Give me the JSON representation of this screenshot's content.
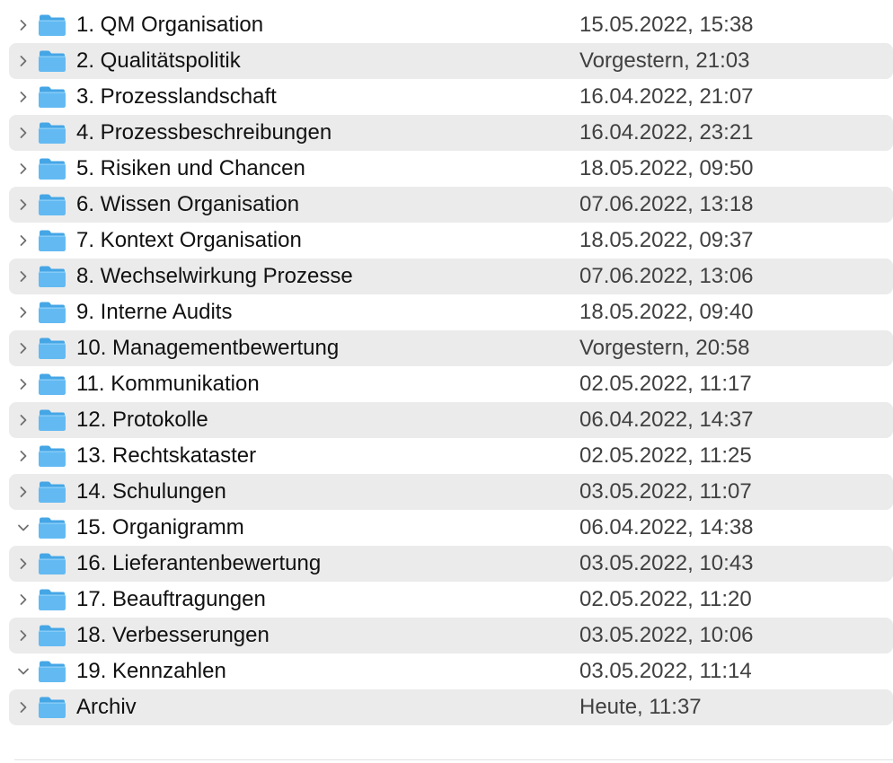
{
  "items": [
    {
      "name": "1. QM Organisation",
      "modified": "15.05.2022, 15:38",
      "expanded": false
    },
    {
      "name": "2. Qualitätspolitik",
      "modified": "Vorgestern, 21:03",
      "expanded": false
    },
    {
      "name": "3. Prozesslandschaft",
      "modified": "16.04.2022, 21:07",
      "expanded": false
    },
    {
      "name": "4. Prozessbeschreibungen",
      "modified": "16.04.2022, 23:21",
      "expanded": false
    },
    {
      "name": "5. Risiken und Chancen",
      "modified": "18.05.2022, 09:50",
      "expanded": false
    },
    {
      "name": "6. Wissen Organisation",
      "modified": "07.06.2022, 13:18",
      "expanded": false
    },
    {
      "name": "7. Kontext Organisation",
      "modified": "18.05.2022, 09:37",
      "expanded": false
    },
    {
      "name": "8. Wechselwirkung Prozesse",
      "modified": "07.06.2022, 13:06",
      "expanded": false
    },
    {
      "name": "9. Interne Audits",
      "modified": "18.05.2022, 09:40",
      "expanded": false
    },
    {
      "name": "10. Managementbewertung",
      "modified": "Vorgestern, 20:58",
      "expanded": false
    },
    {
      "name": "11. Kommunikation",
      "modified": "02.05.2022, 11:17",
      "expanded": false
    },
    {
      "name": "12. Protokolle",
      "modified": "06.04.2022, 14:37",
      "expanded": false
    },
    {
      "name": "13. Rechtskataster",
      "modified": "02.05.2022, 11:25",
      "expanded": false
    },
    {
      "name": "14. Schulungen",
      "modified": "03.05.2022, 11:07",
      "expanded": false
    },
    {
      "name": "15. Organigramm",
      "modified": "06.04.2022, 14:38",
      "expanded": true
    },
    {
      "name": "16. Lieferantenbewertung",
      "modified": "03.05.2022, 10:43",
      "expanded": false
    },
    {
      "name": "17. Beauftragungen",
      "modified": "02.05.2022, 11:20",
      "expanded": false
    },
    {
      "name": "18. Verbesserungen",
      "modified": "03.05.2022, 10:06",
      "expanded": false
    },
    {
      "name": "19. Kennzahlen",
      "modified": "03.05.2022, 11:14",
      "expanded": true
    },
    {
      "name": "Archiv",
      "modified": "Heute, 11:37",
      "expanded": false
    }
  ],
  "icons": {
    "folder": "folder-icon",
    "collapsed": "chevron-right-icon",
    "expanded": "chevron-down-icon"
  },
  "colors": {
    "alt_row": "#ebebeb",
    "folder_front": "#63baf2",
    "folder_back": "#45a6e6",
    "chevron": "#6f6f6f"
  }
}
